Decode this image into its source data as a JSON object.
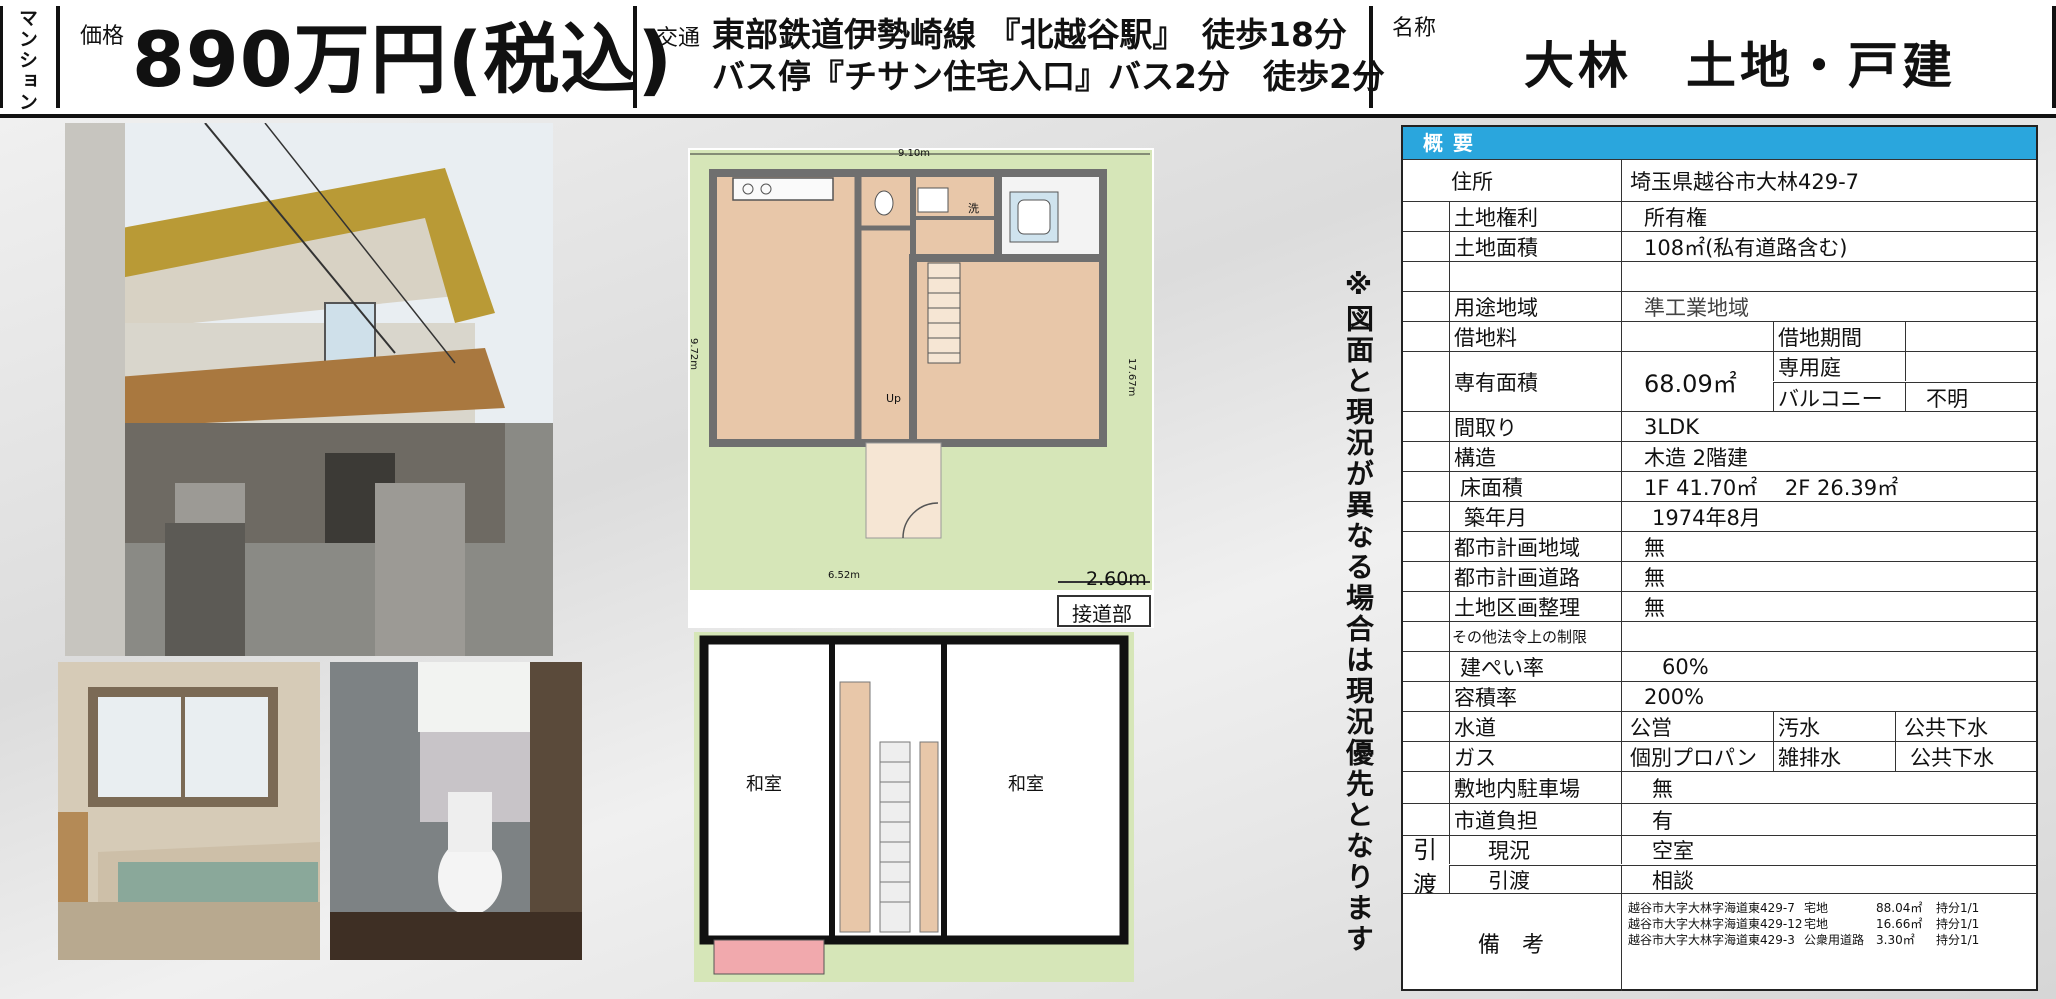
{
  "header": {
    "type_label": "マンション",
    "price_label": "価格",
    "price": "890万円(税込)",
    "transport_label": "交通",
    "transport_line1": "東部鉄道伊勢崎線 『北越谷駅』　徒歩18分",
    "transport_line2": "バス停『チサン住宅入口』バス2分　徒歩2分",
    "name_label": "名称",
    "name": "大林　土地・戸建"
  },
  "plan1": {
    "width_top": "9.10m",
    "height_left": "9.72m",
    "height_right": "17.67m",
    "width_bottom": "6.52m",
    "frontage": "2.60m",
    "road_label": "接道部",
    "stairs_label": "Up",
    "wash_label": "洗"
  },
  "plan2": {
    "room_left": "和室",
    "room_right": "和室"
  },
  "side_note": "※図面と現況が異なる場合は現況優先となります",
  "table": {
    "title": "概要",
    "address_label": "住所",
    "address": "埼玉県越谷市大林429-7",
    "land_right_label": "土地権利",
    "land_right": "所有権",
    "land_area_label": "土地面積",
    "land_area": "108㎡(私有道路含む)",
    "zoning_label": "用途地域",
    "zoning": "準工業地域",
    "lease_fee_label": "借地料",
    "lease_period_label": "借地期間",
    "exclusive_area_label": "専有面積",
    "exclusive_area": "68.09㎡",
    "private_garden_label": "専用庭",
    "balcony_label": "バルコニー",
    "balcony": "不明",
    "layout_label": "間取り",
    "layout": "3LDK",
    "structure_label": "構造",
    "structure": "木造 2階建",
    "floor_area_label": "床面積",
    "floor_area": "1F 41.70㎡　 2F 26.39㎡",
    "built_label": "築年月",
    "built": "1974年8月",
    "city_plan_area_label": "都市計画地域",
    "city_plan_area": "無",
    "city_plan_road_label": "都市計画道路",
    "city_plan_road": "無",
    "land_readjust_label": "土地区画整理",
    "land_readjust": "無",
    "other_restrictions_label": "その他法令上の制限",
    "coverage_label": "建ぺい率",
    "coverage": "60%",
    "far_label": "容積率",
    "far": "200%",
    "water_label": "水道",
    "water": "公営",
    "sewage_label": "汚水",
    "sewage": "公共下水",
    "gas_label": "ガス",
    "gas": "個別プロパン",
    "drainage_label": "雑排水",
    "drainage": "公共下水",
    "parking_label": "敷地内駐車場",
    "parking": "無",
    "road_burden_label": "市道負担",
    "road_burden": "有",
    "handover_label1": "引",
    "handover_label2": "渡",
    "status_label": "現況",
    "status": "空室",
    "handover_label": "引渡",
    "handover": "相談",
    "remarks_label": "備　考",
    "remarks": [
      {
        "addr": "越谷市大字大林字海道東429-7",
        "type": "宅地",
        "area": "88.04㎡",
        "share": "持分1/1"
      },
      {
        "addr": "越谷市大字大林字海道東429-12",
        "type": "宅地",
        "area": "16.66㎡",
        "share": "持分1/1"
      },
      {
        "addr": "越谷市大字大林字海道東429-3",
        "type": "公衆用道路",
        "area": "3.30㎡",
        "share": "持分1/1"
      }
    ]
  },
  "colors": {
    "table_header": "#2aa6dd",
    "wood_floor": "#e8c7a9",
    "grass": "#d6e6b8",
    "wall": "#6f6f6f"
  }
}
